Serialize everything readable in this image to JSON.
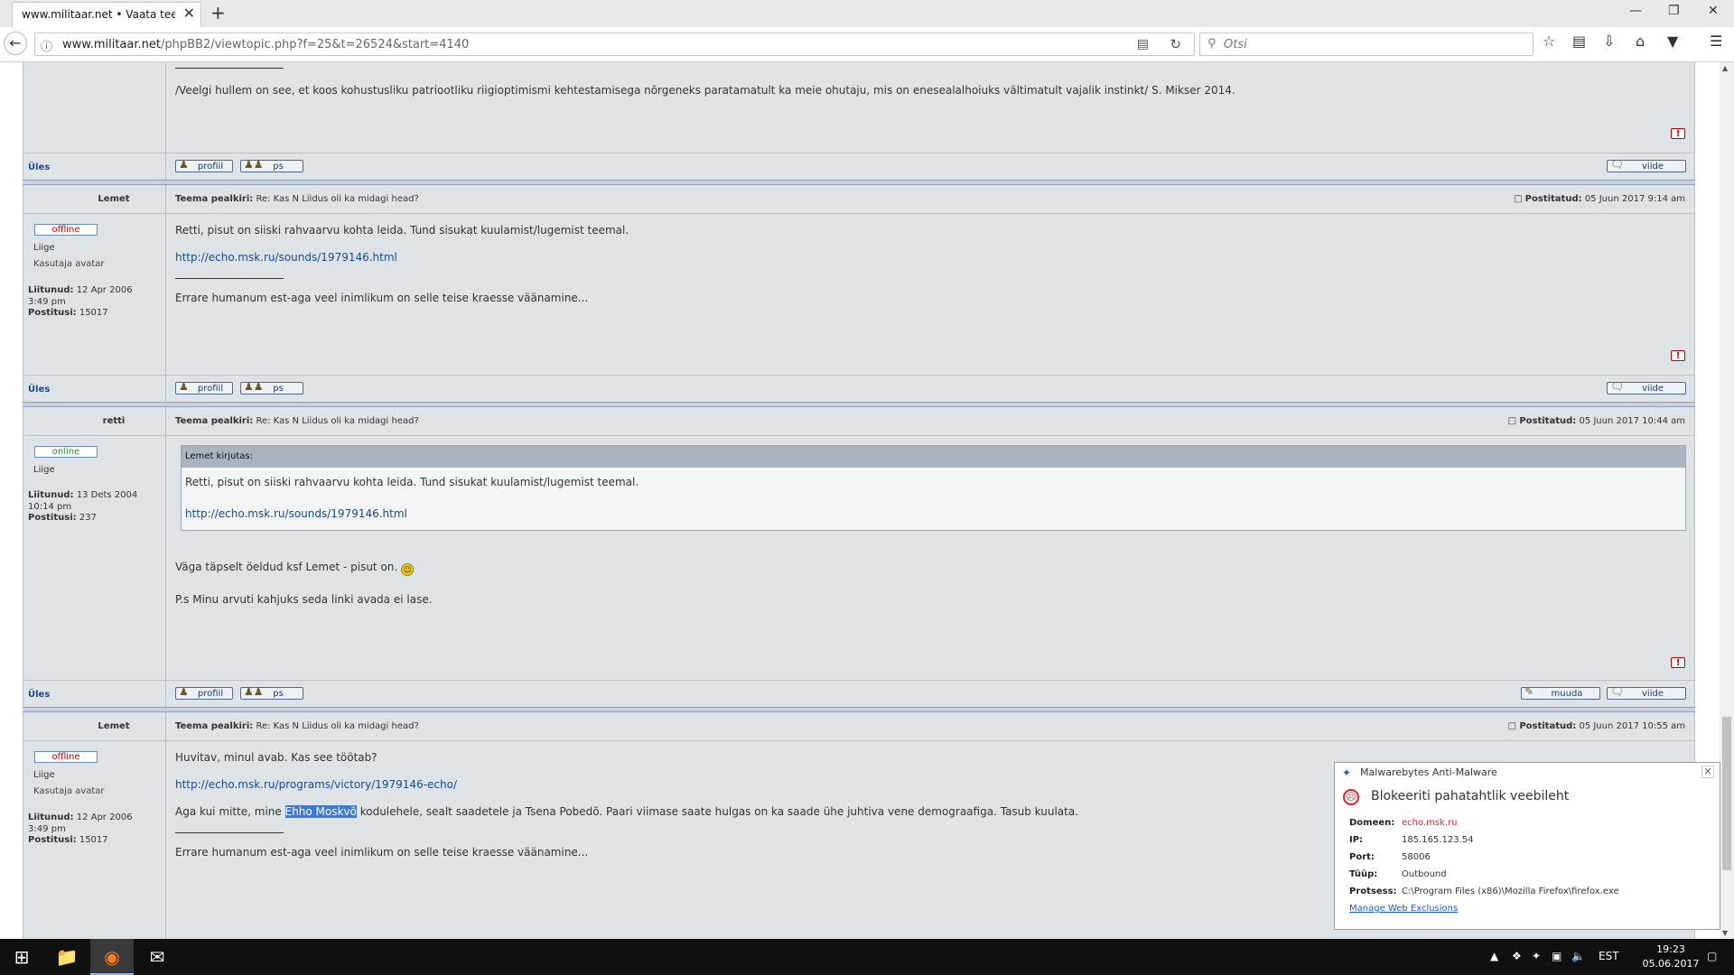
{
  "browser": {
    "tab_title": "www.militaar.net • Vaata teemat",
    "url_domain": "www.militaar.net",
    "url_path": "/phpBB2/viewtopic.php?f=25&t=26524&start=4140",
    "search_placeholder": "Otsi",
    "new_tab": "+",
    "close_glyph": "✕",
    "minimize_glyph": "—",
    "maximize_glyph": "❐"
  },
  "page": {
    "post0": {
      "signature": "/Veelgi hullem on see, et koos kohustusliku patriootliku riigioptimismi kehtestamisega nõrgeneks paratamatult ka meie ohutaju, mis on enesealalhoiuks vältimatult vajalik instinkt/ S. Mikser 2014.",
      "ules": "Üles",
      "btn_profiil": "profiil",
      "btn_ps": "ps",
      "btn_viide": "viide"
    },
    "post1": {
      "author": "Lemet",
      "subject_label": "Teema pealkiri:",
      "subject": "Re: Kas N Liidus oli ka midagi head?",
      "posted_label": "Postitatud:",
      "posted": "05 Juun 2017 9:14 am",
      "status": "offline",
      "rank": "Liige",
      "avatar": "Kasutaja avatar",
      "joined_label": "Liitunud:",
      "joined_1": "12 Apr 2006",
      "joined_2": "3:49 pm",
      "posts_label": "Postitusi:",
      "posts": "15017",
      "body": "Retti, pisut on siiski rahvaarvu kohta leida. Tund sisukat kuulamist/lugemist teemal.",
      "link": "http://echo.msk.ru/sounds/1979146.html",
      "signature": "Errare humanum est-aga veel inimlikum on selle teise kraesse väänamine...",
      "ules": "Üles",
      "btn_profiil": "profiil",
      "btn_ps": "ps",
      "btn_viide": "viide"
    },
    "post2": {
      "author": "retti",
      "subject_label": "Teema pealkiri:",
      "subject": "Re: Kas N Liidus oli ka midagi head?",
      "posted_label": "Postitatud:",
      "posted": "05 Juun 2017 10:44 am",
      "status": "online",
      "rank": "Liige",
      "joined_label": "Liitunud:",
      "joined_1": "13 Dets 2004",
      "joined_2": "10:14 pm",
      "posts_label": "Postitusi:",
      "posts": "237",
      "quote_header": "Lemet kirjutas:",
      "quote_body": "Retti, pisut on siiski rahvaarvu kohta leida. Tund sisukat kuulamist/lugemist teemal.",
      "quote_link": "http://echo.msk.ru/sounds/1979146.html",
      "body1": "Väga täpselt öeldud ksf Lemet - pisut on.",
      "body2": "P.s Minu arvuti kahjuks seda linki avada ei lase.",
      "ules": "Üles",
      "btn_profiil": "profiil",
      "btn_ps": "ps",
      "btn_muuda": "muuda",
      "btn_viide": "viide"
    },
    "post3": {
      "author": "Lemet",
      "subject_label": "Teema pealkiri:",
      "subject": "Re: Kas N Liidus oli ka midagi head?",
      "posted_label": "Postitatud:",
      "posted": "05 Juun 2017 10:55 am",
      "status": "offline",
      "rank": "Liige",
      "avatar": "Kasutaja avatar",
      "joined_label": "Liitunud:",
      "joined_1": "12 Apr 2006",
      "joined_2": "3:49 pm",
      "posts_label": "Postitusi:",
      "posts": "15017",
      "body1": "Huvitav, minul avab. Kas see töötab?",
      "link": "http://echo.msk.ru/programs/victory/1979146-echo/",
      "body2_pre": "Aga kui mitte, mine ",
      "body2_hl": "Ehho Moskvõ",
      "body2_post": " kodulehele, sealt saadetele ja Tsena Pobedõ. Paari viimase saate hulgas on ka saade ühe juhtiva vene demograafiga. Tasub kuulata.",
      "signature": "Errare humanum est-aga veel inimlikum on selle teise kraesse väänamine..."
    }
  },
  "popup": {
    "app": "Malwarebytes Anti-Malware",
    "title": "Blokeeriti pahatahtlik veebileht",
    "domain_label": "Domeen:",
    "domain": "echo.msk.ru",
    "ip_label": "IP:",
    "ip": "185.165.123.54",
    "port_label": "Port:",
    "port": "58006",
    "type_label": "Tüüp:",
    "type": "Outbound",
    "process_label": "Protsess:",
    "process": "C:\\Program Files (x86)\\Mozilla Firefox\\firefox.exe",
    "manage": "Manage Web Exclusions"
  },
  "taskbar": {
    "lang": "EST",
    "time": "19:23",
    "date": "05.06.2017"
  },
  "colors": {
    "post_bg": "#dee3e8",
    "link": "#1a4a8a",
    "offline": "#c00000",
    "online": "#2a8a2a"
  }
}
